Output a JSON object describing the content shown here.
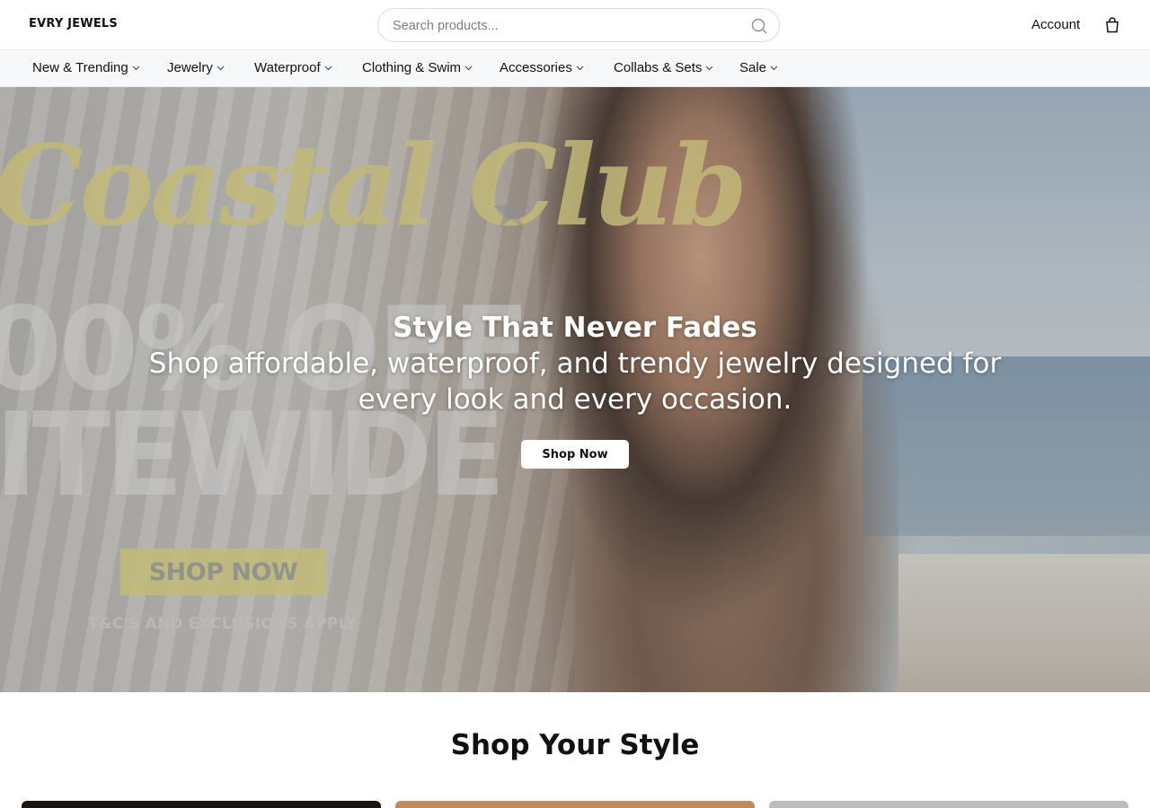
{
  "header": {
    "logo": "EVRY JEWELS",
    "search_placeholder": "Search products...",
    "account_label": "Account"
  },
  "nav": {
    "items": [
      {
        "label": "New & Trending"
      },
      {
        "label": "Jewelry"
      },
      {
        "label": "Waterproof"
      },
      {
        "label": "Clothing & Swim"
      },
      {
        "label": "Accessories"
      },
      {
        "label": "Collabs & Sets"
      },
      {
        "label": "Sale"
      }
    ]
  },
  "hero": {
    "banner_script": "Coastal Club",
    "banner_big_line1": "00% OFF",
    "banner_big_line2": "ITEWIDE",
    "banner_button": "SHOP NOW",
    "banner_terms": "T&C'S AND EXCLUSIONS APPLY",
    "headline": "Style That Never Fades",
    "subheadline": "Shop affordable, waterproof, and trendy jewelry designed for every look and every occasion.",
    "cta": "Shop Now"
  },
  "section": {
    "title": "Shop Your Style"
  }
}
